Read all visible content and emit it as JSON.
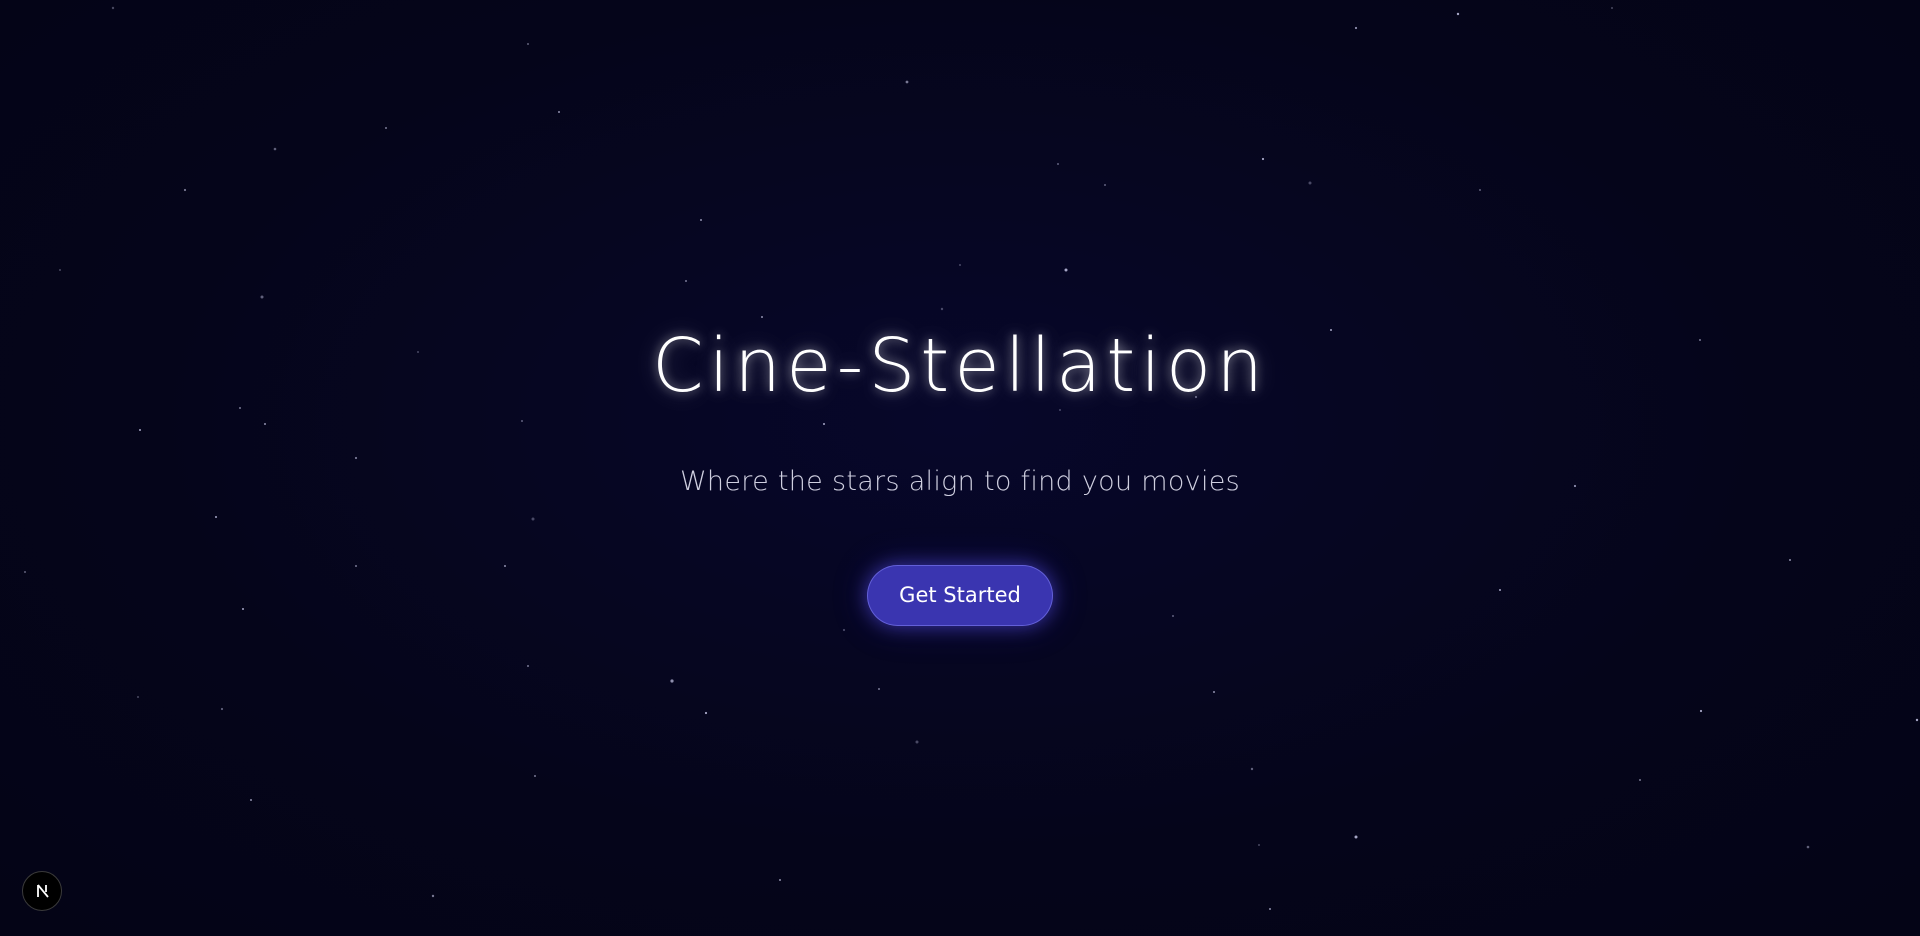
{
  "hero": {
    "title": "Cine-Stellation",
    "subtitle": "Where the stars align to find you movies",
    "cta_label": "Get Started"
  },
  "colors": {
    "background": "#05051a",
    "title": "#ffffff",
    "subtitle": "#cfcfe0",
    "button": "#3a35b0",
    "star": "#c8c8e8"
  },
  "icons": {
    "dev_badge": "next-logo-icon"
  }
}
